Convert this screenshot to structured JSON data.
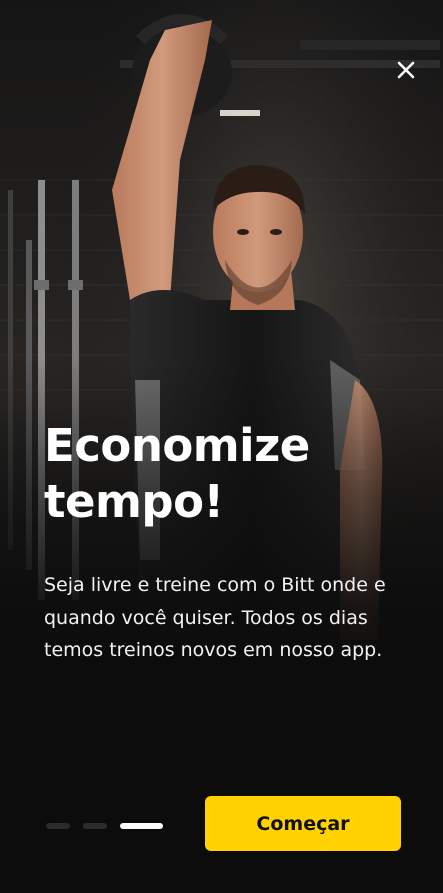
{
  "onboarding": {
    "headline_line1": "Economize",
    "headline_line2": "tempo!",
    "description": "Seja livre e treine com o Bitt onde e quando você quiser. Todos os dias temos treinos novos em nosso app.",
    "cta_label": "Começar",
    "close_icon": "close-icon",
    "pager": {
      "total_pages": 3,
      "current_page": 3
    }
  },
  "theme": {
    "accent": "#FFD200",
    "background": "#0C0C0C",
    "text_primary": "#FFFFFF",
    "dot_inactive": "#2B2B2B",
    "dot_active": "#FFFFFF"
  }
}
